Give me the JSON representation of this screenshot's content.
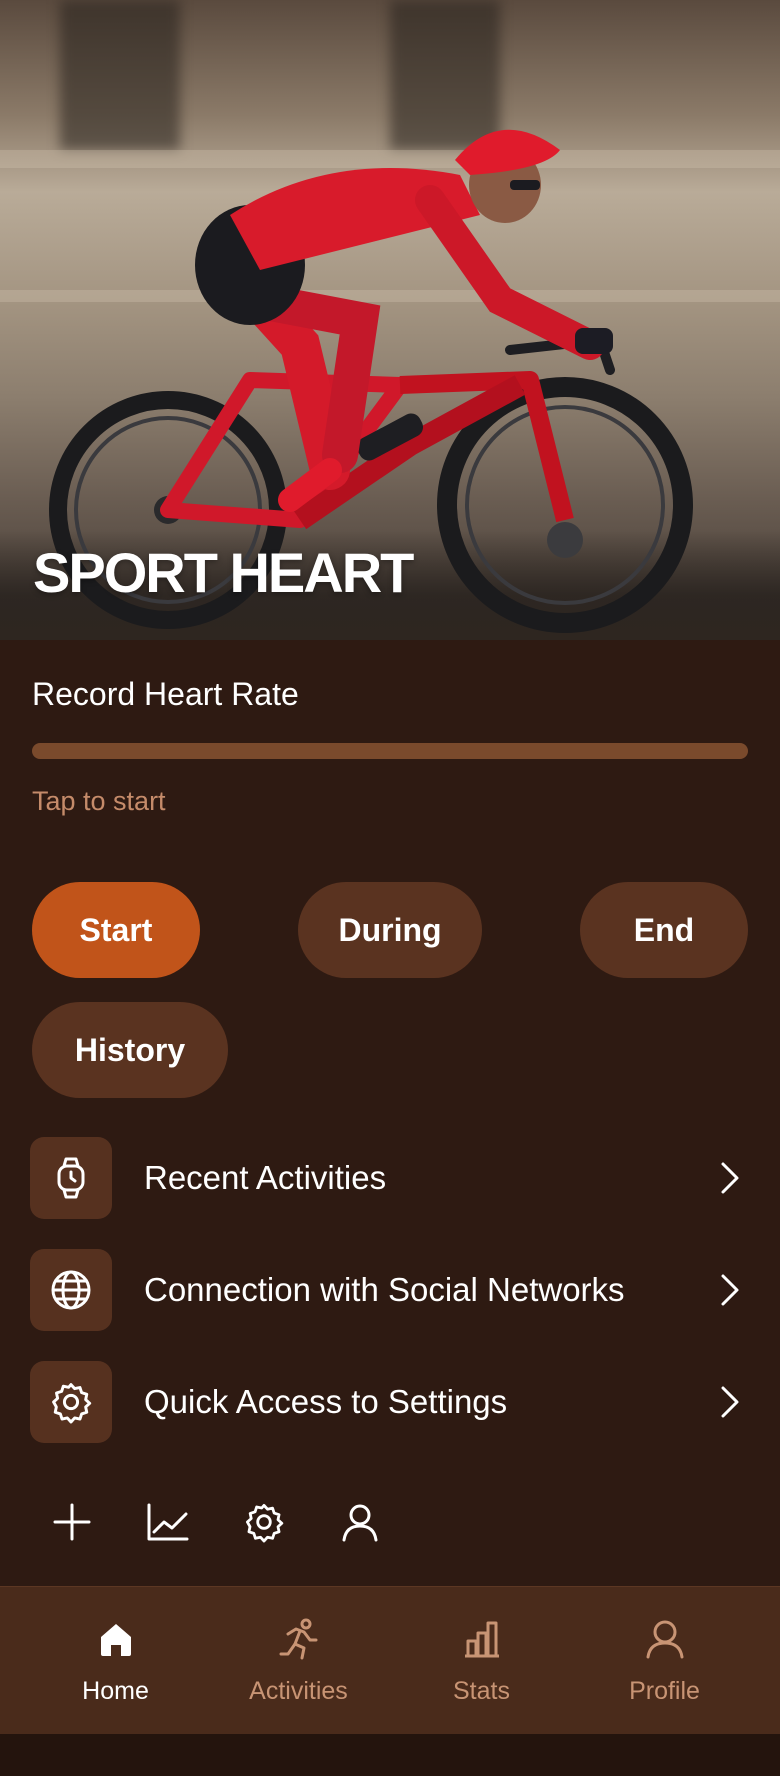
{
  "hero": {
    "title": "SPORT HEART"
  },
  "record": {
    "label": "Record Heart Rate",
    "progress": 0,
    "hint": "Tap to start"
  },
  "phases": [
    {
      "label": "Start",
      "active": true
    },
    {
      "label": "During",
      "active": false
    },
    {
      "label": "End",
      "active": false
    },
    {
      "label": "History",
      "active": false
    }
  ],
  "menu": [
    {
      "label": "Recent Activities",
      "icon": "watch-icon"
    },
    {
      "label": "Connection with Social Networks",
      "icon": "globe-icon"
    },
    {
      "label": "Quick Access to Settings",
      "icon": "gear-icon"
    }
  ],
  "quick_actions": [
    {
      "icon": "plus-icon"
    },
    {
      "icon": "line-chart-icon"
    },
    {
      "icon": "gear-icon"
    },
    {
      "icon": "user-icon"
    }
  ],
  "nav": [
    {
      "label": "Home",
      "icon": "home-icon",
      "active": true
    },
    {
      "label": "Activities",
      "icon": "running-icon",
      "active": false
    },
    {
      "label": "Stats",
      "icon": "bar-chart-icon",
      "active": false
    },
    {
      "label": "Profile",
      "icon": "user-icon",
      "active": false
    }
  ],
  "colors": {
    "background": "#2e1a12",
    "accent": "#c1541a",
    "pill": "#5a3320",
    "nav_background": "#4a2b1b",
    "muted_text": "#c89474"
  }
}
